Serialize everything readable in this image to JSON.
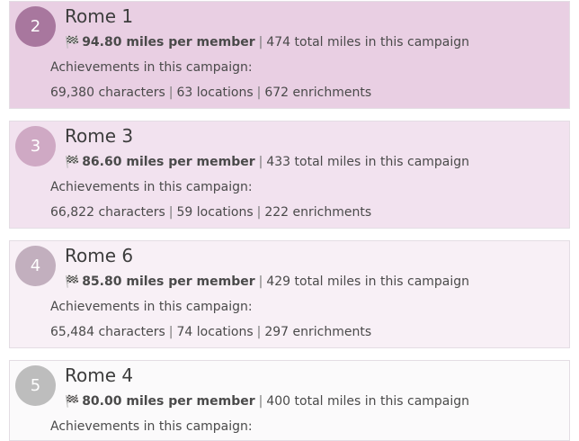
{
  "labels": {
    "achievements": "Achievements in this campaign:",
    "per_member_suffix": "miles per member",
    "total_suffix": "total miles in this campaign",
    "characters_suffix": "characters",
    "locations_suffix": "locations",
    "enrichments_suffix": "enrichments",
    "separator": "|"
  },
  "colors": {
    "card_1_bg": "#e9cfe3",
    "card_2_bg": "#f2e2ef",
    "card_3_bg": "#f8f0f6",
    "card_4_bg": "#fbfafb",
    "badge_1": "#a8779e",
    "badge_2": "#cfa9c4",
    "badge_3": "#c2afbe",
    "badge_4": "#bdbdbd"
  },
  "leaderboard": [
    {
      "rank": "2",
      "name": "Rome 1",
      "miles_per_member": "94.80",
      "total_miles": "474",
      "characters": "69,380",
      "locations": "63",
      "enrichments": "672"
    },
    {
      "rank": "3",
      "name": "Rome 3",
      "miles_per_member": "86.60",
      "total_miles": "433",
      "characters": "66,822",
      "locations": "59",
      "enrichments": "222"
    },
    {
      "rank": "4",
      "name": "Rome 6",
      "miles_per_member": "85.80",
      "total_miles": "429",
      "characters": "65,484",
      "locations": "74",
      "enrichments": "297"
    },
    {
      "rank": "5",
      "name": "Rome 4",
      "miles_per_member": "80.00",
      "total_miles": "400",
      "characters": "",
      "locations": "",
      "enrichments": ""
    }
  ]
}
